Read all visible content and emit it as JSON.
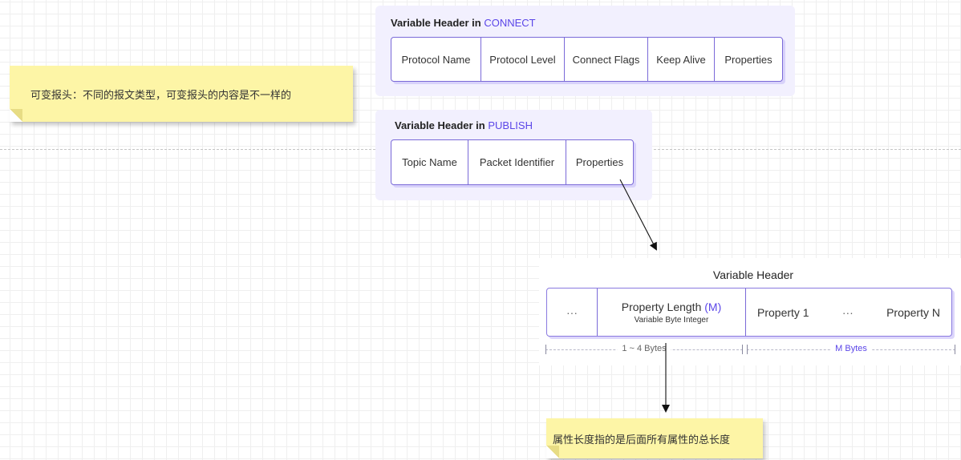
{
  "note_top": "可变报头：不同的报文类型，可变报头的内容是不一样的",
  "note_bottom": "属性长度指的是后面所有属性的总长度",
  "connect": {
    "title_prefix": "Variable Header in ",
    "title_accent": "CONNECT",
    "fields": [
      "Protocol Name",
      "Protocol Level",
      "Connect Flags",
      "Keep Alive",
      "Properties"
    ]
  },
  "publish": {
    "title_prefix": "Variable Header in ",
    "title_accent": "PUBLISH",
    "fields": [
      "Topic Name",
      "Packet Identifier",
      "Properties"
    ]
  },
  "variable_header": {
    "title": "Variable Header",
    "ellipsis_left": "···",
    "property_length": "Property Length ",
    "property_length_m": "(M)",
    "property_length_sub": "Variable Byte Integer",
    "property_1": "Property 1",
    "ellipsis_mid": "···",
    "property_n": "Property N",
    "dim_left": "1 ~ 4 Bytes",
    "dim_right": "M Bytes"
  },
  "colors": {
    "accent": "#5b46e8",
    "panel_bg": "#f2f0fe",
    "note_bg": "#fdf5a6"
  }
}
